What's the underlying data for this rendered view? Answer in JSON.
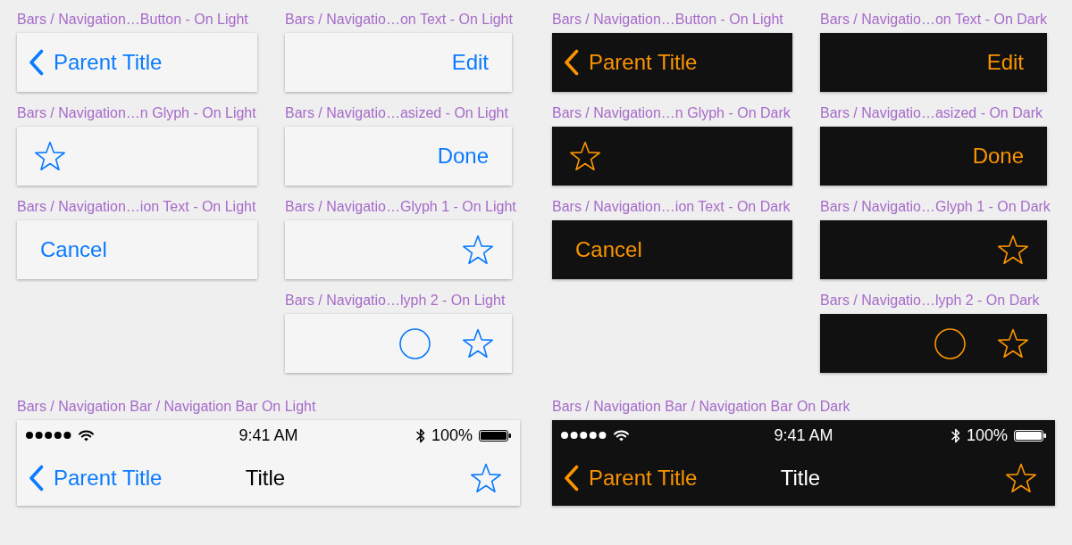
{
  "themes": [
    {
      "kind": "light",
      "columns": [
        [
          {
            "label": "Bars / Navigation…Button - On Light",
            "kind": "back_button",
            "text": "Parent Title"
          },
          {
            "label": "Bars / Navigation…n Glyph - On Light",
            "kind": "leading_glyph"
          },
          {
            "label": "Bars / Navigation…ion Text - On Light",
            "kind": "leading_text",
            "text": "Cancel"
          }
        ],
        [
          {
            "label": "Bars / Navigatio…on Text - On Light",
            "kind": "trailing_text",
            "text": "Edit"
          },
          {
            "label": "Bars / Navigatio…asized - On Light",
            "kind": "trailing_text",
            "text": "Done"
          },
          {
            "label": "Bars / Navigatio…Glyph 1 - On Light",
            "kind": "trailing_glyph"
          },
          {
            "label": "Bars / Navigatio…lyph 2 - On Light",
            "kind": "trailing_glyphs"
          }
        ]
      ],
      "navigation_bar": {
        "label": "Bars / Navigation Bar / Navigation Bar On Light",
        "time": "9:41 AM",
        "battery": "100%",
        "back_text": "Parent Title",
        "title": "Title"
      }
    },
    {
      "kind": "dark",
      "columns": [
        [
          {
            "label": "Bars / Navigation…Button - On Light",
            "kind": "back_button",
            "text": "Parent Title"
          },
          {
            "label": "Bars / Navigation…n Glyph - On Dark",
            "kind": "leading_glyph"
          },
          {
            "label": "Bars / Navigation…ion Text - On Dark",
            "kind": "leading_text",
            "text": "Cancel"
          }
        ],
        [
          {
            "label": "Bars / Navigatio…on Text - On Dark",
            "kind": "trailing_text",
            "text": "Edit"
          },
          {
            "label": "Bars / Navigatio…asized - On Dark",
            "kind": "trailing_text",
            "text": "Done"
          },
          {
            "label": "Bars / Navigatio…Glyph 1 - On Dark",
            "kind": "trailing_glyph"
          },
          {
            "label": "Bars / Navigatio…lyph 2 - On Dark",
            "kind": "trailing_glyphs"
          }
        ]
      ],
      "navigation_bar": {
        "label": "Bars / Navigation Bar / Navigation Bar On Dark",
        "time": "9:41 AM",
        "battery": "100%",
        "back_text": "Parent Title",
        "title": "Title"
      }
    }
  ]
}
